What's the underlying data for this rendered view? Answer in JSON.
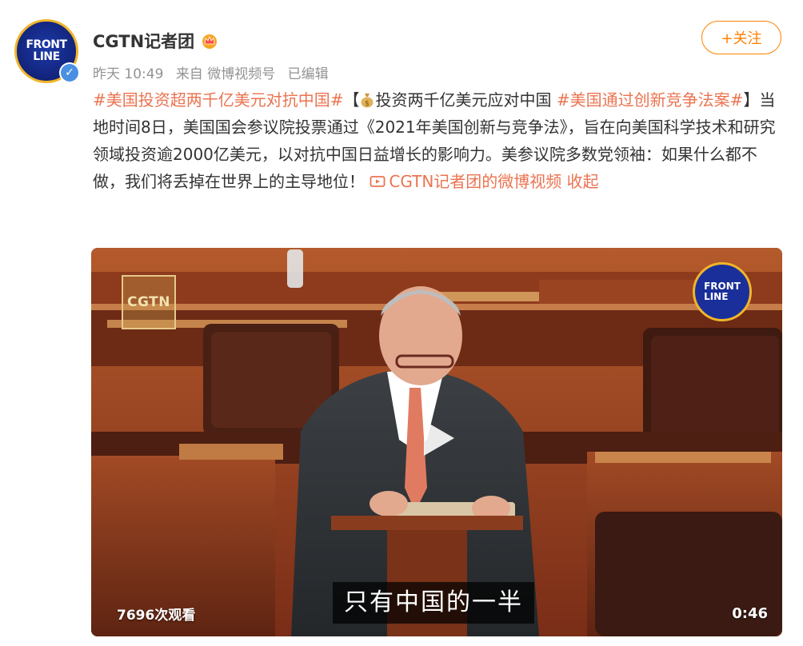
{
  "account": {
    "name": "CGTN记者团",
    "avatar_text_line1": "FRONT",
    "avatar_text_line2": "LINE",
    "verified": true
  },
  "meta": {
    "time": "昨天 10:49",
    "source": "来自 微博视频号",
    "edited": "已编辑"
  },
  "follow_button": {
    "label": "+关注"
  },
  "post": {
    "tag1": "#美国投资超两千亿美元对抗中国#",
    "bracket_open": "【",
    "bracket_title": "投资两千亿美元应对中国",
    "tag2": "#美国通过创新竞争法案#",
    "body": "】当地时间8日，美国国会参议院投票通过《2021年美国创新与竞争法》，旨在向美国科学技术和研究领域投资逾2000亿美元，以对抗中国日益增长的影响力。美参议院多数党领袖：如果什么都不做，我们将丢掉在世界上的主导地位！",
    "video_link": "CGTN记者团的微博视频",
    "collapse": "收起"
  },
  "video": {
    "channel_logo": "CGTN",
    "front_logo_line1": "FRONT",
    "front_logo_line2": "LINE",
    "subtitle": "只有中国的一半",
    "views": "7696次观看",
    "duration": "0:46"
  },
  "colors": {
    "accent": "#ff8200",
    "link": "#eb7350",
    "meta_text": "#939393",
    "verify_blue": "#4a90e2"
  }
}
